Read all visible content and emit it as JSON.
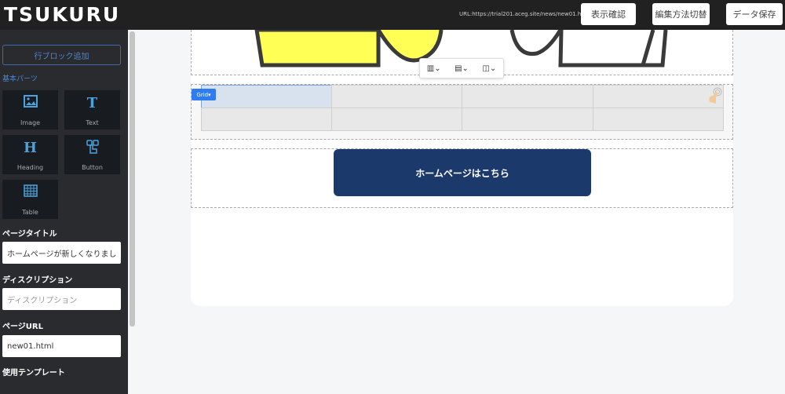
{
  "header": {
    "logo": "TSUKURU",
    "url": "URL:https://trial201.aceg.site/news/new01.html",
    "preview": "表示確認",
    "switch_mode": "編集方法切替",
    "save": "データ保存"
  },
  "sidebar": {
    "add_row": "行ブロック追加",
    "basic_parts": "基本パーツ",
    "parts": [
      {
        "label": "Image",
        "icon": "image-icon"
      },
      {
        "label": "Text",
        "icon": "text-icon"
      },
      {
        "label": "Heading",
        "icon": "heading-icon"
      },
      {
        "label": "Button",
        "icon": "button-icon"
      },
      {
        "label": "Table",
        "icon": "table-icon"
      }
    ],
    "page_title_label": "ページタイトル",
    "page_title_value": "ホームページが新しくなりまし",
    "description_label": "ディスクリプション",
    "description_placeholder": "ディスクリプション",
    "page_url_label": "ページURL",
    "page_url_value": "new01.html",
    "template_label": "使用テンプレート"
  },
  "editor": {
    "grid_badge": "Grid▾",
    "cta_button": "ホームページはこちら",
    "accent": "#2f7bf0",
    "cta_color": "#1b3a6b"
  }
}
